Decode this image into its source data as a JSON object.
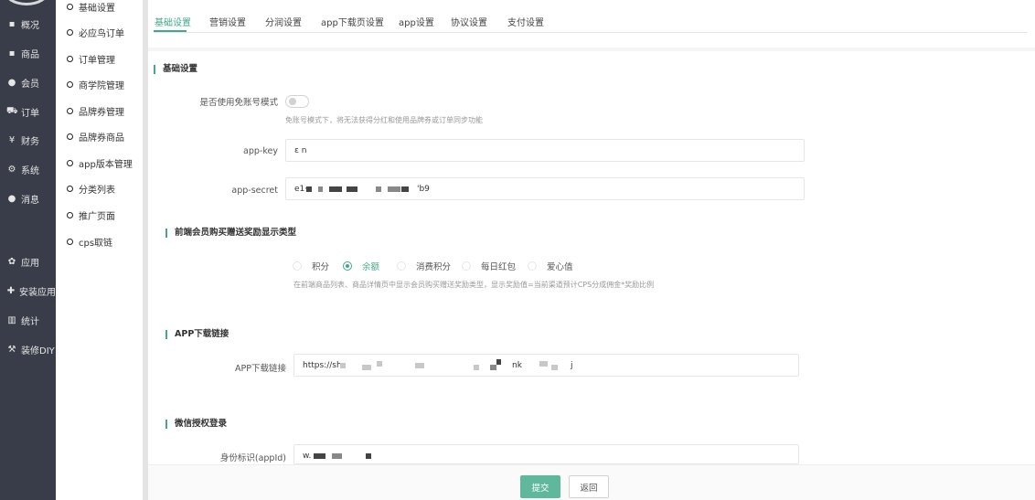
{
  "sidebar": {
    "items": [
      {
        "label": "概况",
        "icon": "monitor-icon"
      },
      {
        "label": "商品",
        "icon": "goods-icon"
      },
      {
        "label": "会员",
        "icon": "users-icon"
      },
      {
        "label": "订单",
        "icon": "cart-icon"
      },
      {
        "label": "财务",
        "icon": "yen-icon"
      },
      {
        "label": "系统",
        "icon": "gears-icon"
      },
      {
        "label": "消息",
        "icon": "chat-icon"
      },
      {
        "label": "应用",
        "icon": "apps-icon"
      },
      {
        "label": "安装应用",
        "icon": "puzzle-icon"
      },
      {
        "label": "统计",
        "icon": "bar-chart-icon"
      },
      {
        "label": "装修DIY",
        "icon": "hammer-icon"
      }
    ]
  },
  "submenu": {
    "items": [
      "基础设置",
      "必应鸟订单",
      "订单管理",
      "商学院管理",
      "品牌券管理",
      "品牌券商品",
      "app版本管理",
      "分类列表",
      "推广页面",
      "cps取链"
    ]
  },
  "tabs": [
    "基础设置",
    "营销设置",
    "分润设置",
    "app下载页设置",
    "app设置",
    "协议设置",
    "支付设置"
  ],
  "active_tab": "基础设置",
  "accent_color": "#41a889",
  "sections": {
    "basic": {
      "title": "基础设置",
      "free_account_label": "是否使用免账号模式",
      "free_account_enabled": false,
      "free_account_hint": "免账号模式下，将无法获得分红和使用品牌券或订单同步功能",
      "app_key_label": "app-key",
      "app_key_value": "ε    n",
      "app_secret_label": "app-secret",
      "app_secret_prefix": "e1·",
      "app_secret_suffix": "'b9"
    },
    "reward": {
      "title": "前端会员购买赠送奖励显示类型",
      "options": [
        "积分",
        "余额",
        "消费积分",
        "每日红包",
        "爱心值"
      ],
      "selected": "余额",
      "hint": "在前端商品列表、商品详情页中显示会员购买赠送奖励类型，显示奖励值=当前渠道预计CPS分成佣金*奖励比例"
    },
    "app_download": {
      "title": "APP下载链接",
      "label": "APP下载链接",
      "value_prefix": "https://sh",
      "value_middle": "nk",
      "value_suffix": "j"
    },
    "wechat": {
      "title": "微信授权登录",
      "appid_label": "身份标识(appId)",
      "appid_prefix": "w."
    }
  },
  "buttons": {
    "submit": "提交",
    "back": "返回"
  }
}
